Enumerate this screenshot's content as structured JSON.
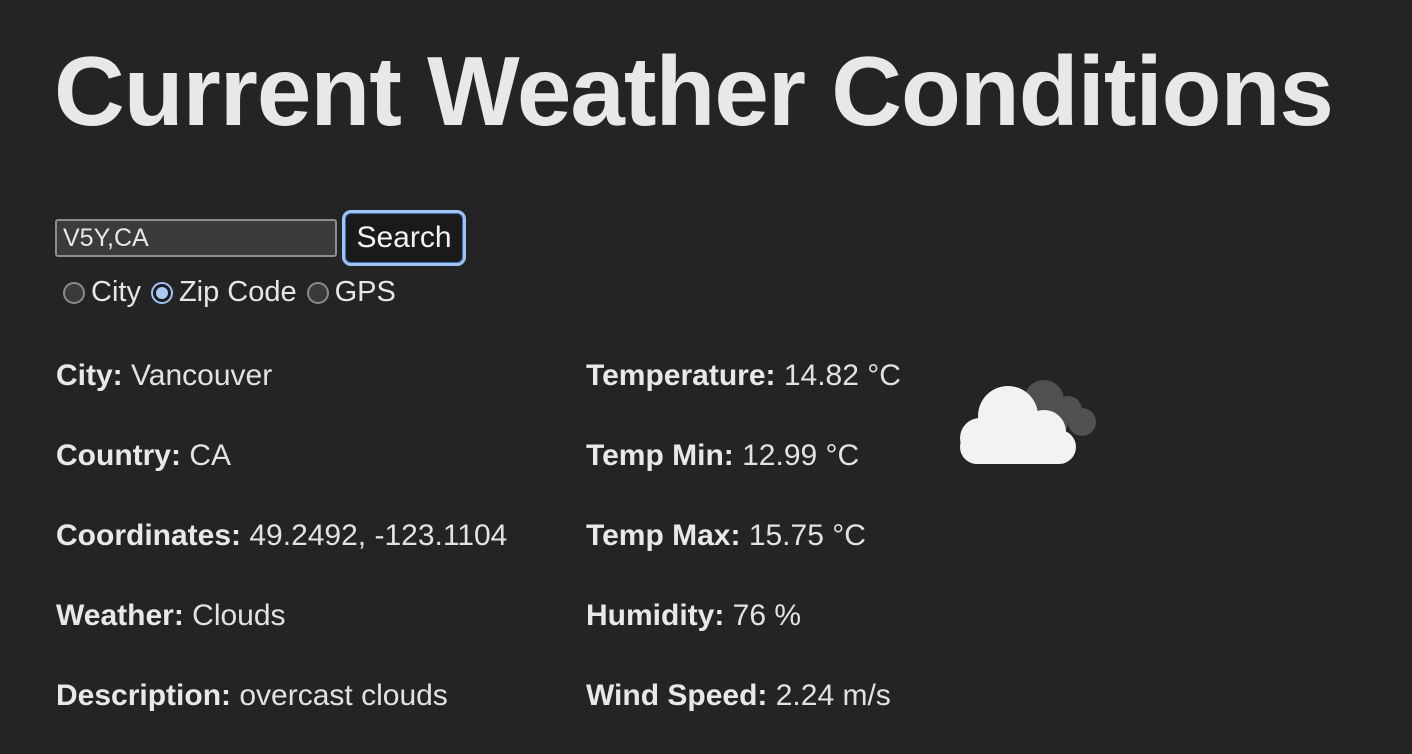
{
  "page": {
    "title": "Current Weather Conditions"
  },
  "search": {
    "value": "V5Y,CA",
    "button_label": "Search"
  },
  "modes": [
    {
      "label": "City",
      "checked": false
    },
    {
      "label": "Zip Code",
      "checked": true
    },
    {
      "label": "GPS",
      "checked": false
    }
  ],
  "location": {
    "city_label": "City:",
    "city": "Vancouver",
    "country_label": "Country:",
    "country": "CA",
    "coordinates_label": "Coordinates:",
    "coordinates": "49.2492, -123.1104",
    "weather_label": "Weather:",
    "weather": "Clouds",
    "description_label": "Description:",
    "description": "overcast clouds"
  },
  "conditions": {
    "temperature_label": "Temperature:",
    "temperature": "14.82 °C",
    "temp_min_label": "Temp Min:",
    "temp_min": "12.99 °C",
    "temp_max_label": "Temp Max:",
    "temp_max": "15.75 °C",
    "humidity_label": "Humidity:",
    "humidity": "76 %",
    "wind_speed_label": "Wind Speed:",
    "wind_speed": "2.24 m/s"
  },
  "icon": {
    "name": "overcast-clouds-icon",
    "front_color": "#f2f2f2",
    "back_color": "#505050"
  }
}
